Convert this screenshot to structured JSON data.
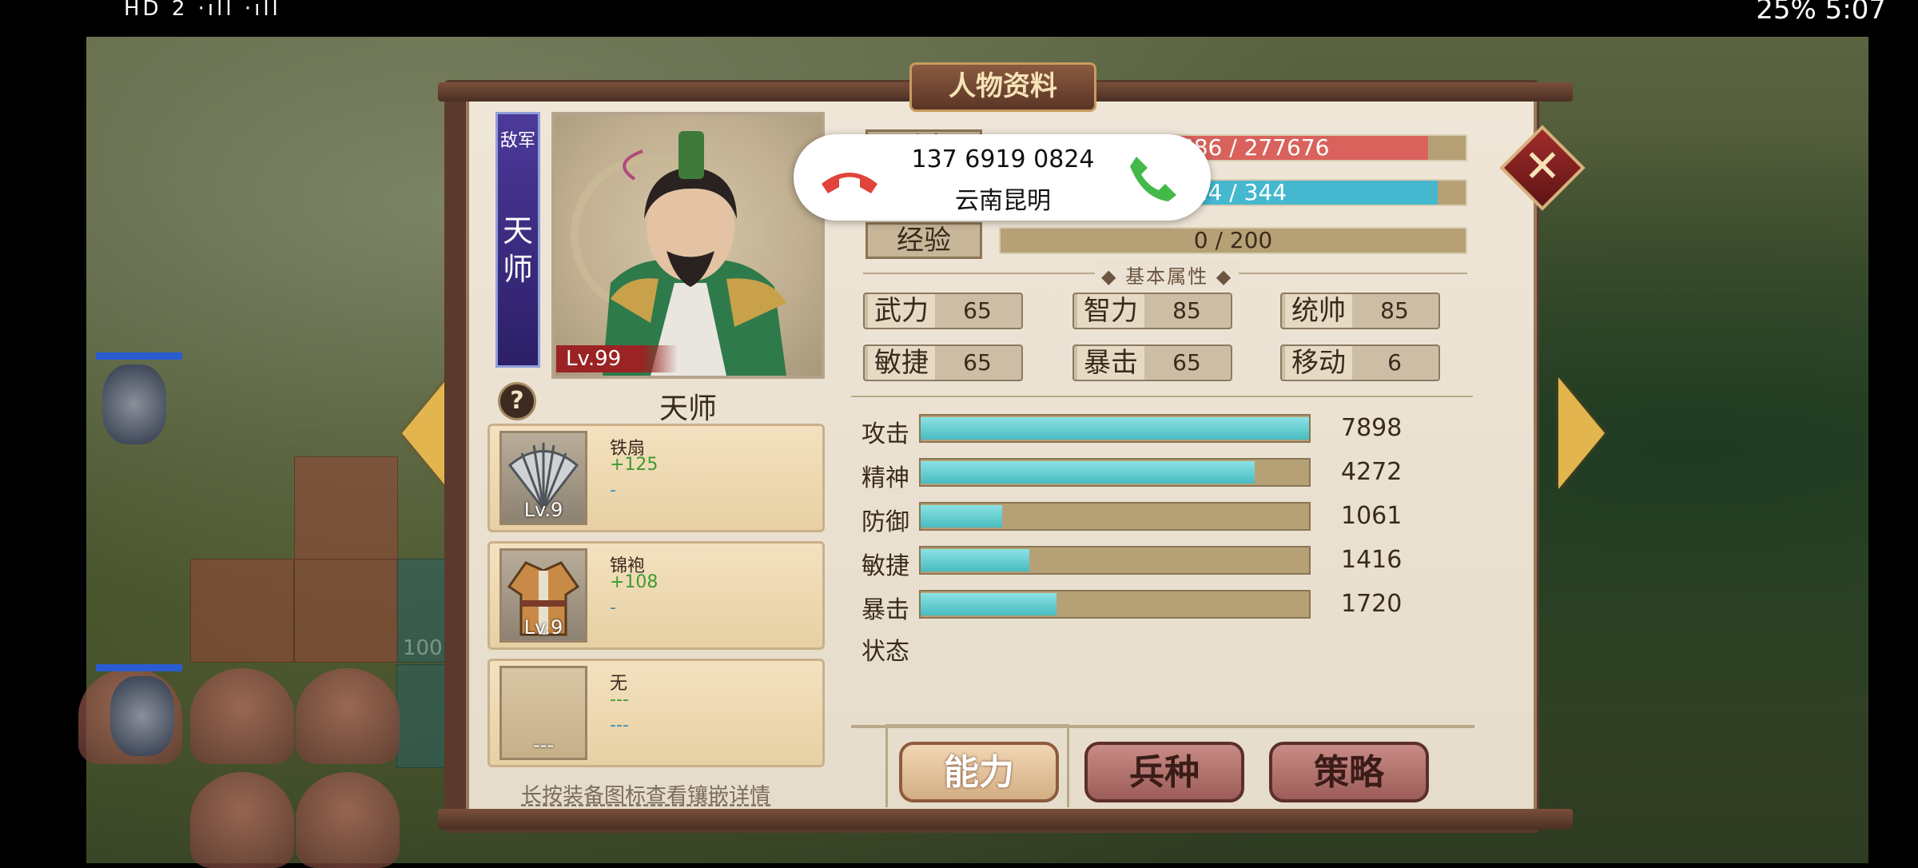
{
  "status_bar": {
    "left_text": "HD 2 ·ıll ·ıll",
    "right_text": "25% 5:07"
  },
  "scene": {
    "tile_labels": [
      "100",
      "100",
      "100",
      "100",
      "100",
      "100"
    ]
  },
  "dialog": {
    "title": "人物资料",
    "faction": "敌军",
    "banner_name": "天\n师",
    "portrait_level": "Lv.99",
    "character_name": "天师",
    "help_icon": "?",
    "close_icon": "✕",
    "resources": {
      "hp": {
        "label": "兵力",
        "text": "255686 / 277676",
        "fraction": 0.92
      },
      "mp": {
        "label": "法力",
        "text": "324 / 344",
        "fraction": 0.94
      },
      "exp": {
        "label": "经验",
        "text": "0 / 200",
        "fraction": 0.0
      }
    },
    "section_title": "◆ 基本属性 ◆",
    "base_stats": [
      {
        "key": "武力",
        "value": "65"
      },
      {
        "key": "智力",
        "value": "85"
      },
      {
        "key": "统帅",
        "value": "85"
      },
      {
        "key": "敏捷",
        "value": "65"
      },
      {
        "key": "暴击",
        "value": "65"
      },
      {
        "key": "移动",
        "value": "6"
      }
    ],
    "combat_stats": [
      {
        "label": "攻击",
        "value": "7898",
        "fraction": 1.0
      },
      {
        "label": "精神",
        "value": "4272",
        "fraction": 0.86
      },
      {
        "label": "防御",
        "value": "1061",
        "fraction": 0.21
      },
      {
        "label": "敏捷",
        "value": "1416",
        "fraction": 0.28
      },
      {
        "label": "暴击",
        "value": "1720",
        "fraction": 0.35
      }
    ],
    "status_label": "状态",
    "equipment": [
      {
        "name": "铁扇",
        "bonus": "+125",
        "sub": "-",
        "level": "Lv.9",
        "icon": "fan-icon"
      },
      {
        "name": "锦袍",
        "bonus": "+108",
        "sub": "-",
        "level": "Lv.9",
        "icon": "robe-icon"
      },
      {
        "name": "无",
        "bonus": "---",
        "sub": "---",
        "level": "---",
        "icon": "empty-slot-icon"
      }
    ],
    "hint": "长按装备图标查看镶嵌详情",
    "tabs": [
      {
        "label": "能力",
        "active": true
      },
      {
        "label": "兵种",
        "active": false
      },
      {
        "label": "策略",
        "active": false
      }
    ]
  },
  "incoming_call": {
    "number": "137 6919 0824",
    "location": "云南昆明"
  },
  "colors": {
    "hp": "#d9625c",
    "mp": "#45b8cf",
    "combat_fill": "#55c3c7",
    "accent_gold": "#e3b54f"
  }
}
